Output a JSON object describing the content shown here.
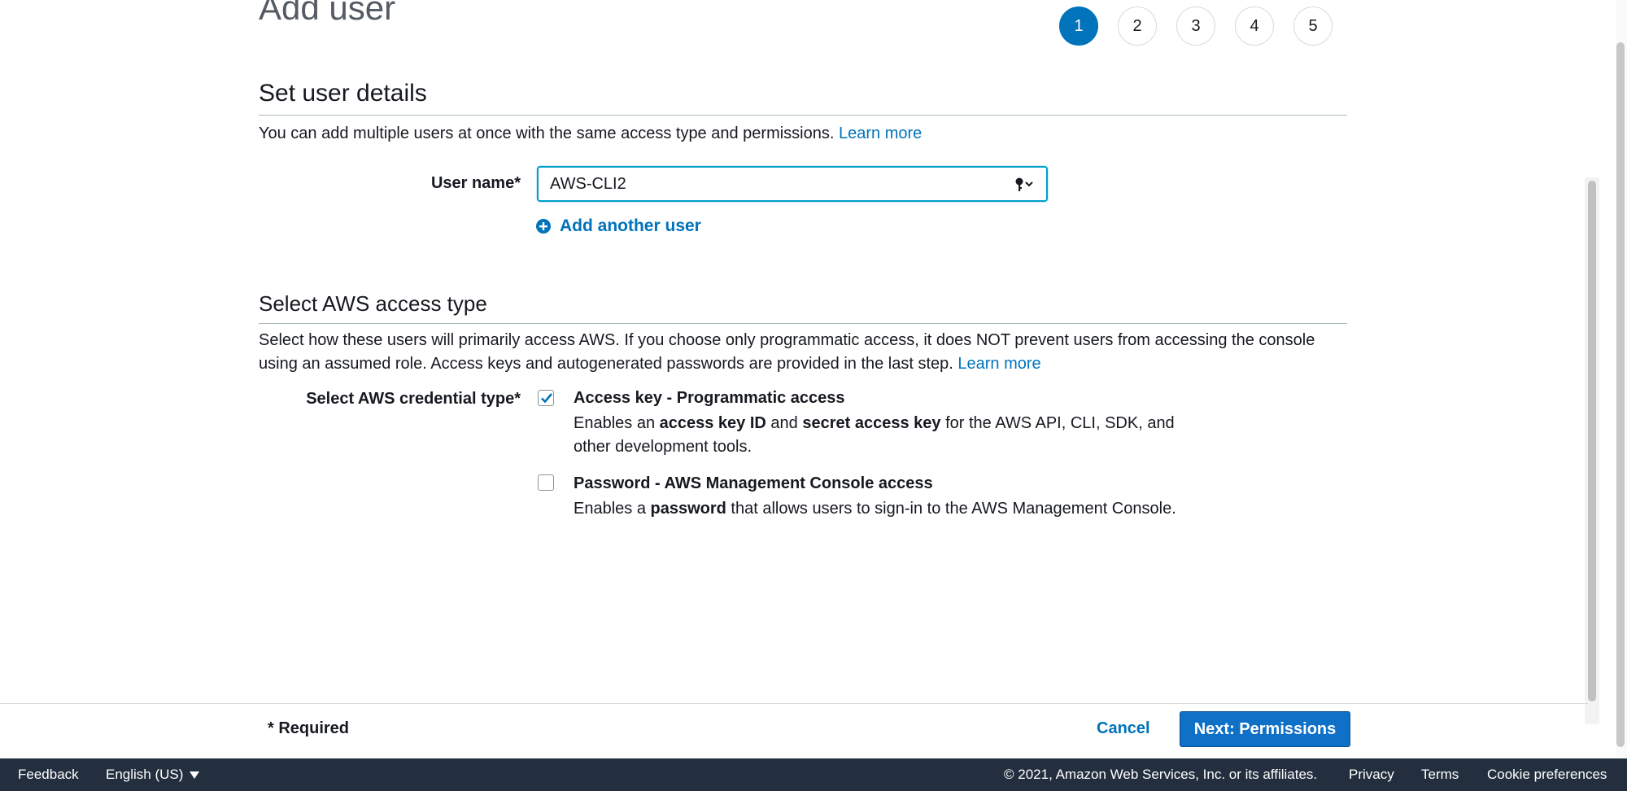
{
  "page_title": "Add user",
  "steps": [
    "1",
    "2",
    "3",
    "4",
    "5"
  ],
  "active_step": "1",
  "details": {
    "title": "Set user details",
    "description": "You can add multiple users at once with the same access type and permissions.",
    "learn_more": "Learn more",
    "user_name_label": "User name*",
    "user_name_value": "AWS-CLI2",
    "add_another_user": "Add another user"
  },
  "access": {
    "title": "Select AWS access type",
    "description": "Select how these users will primarily access AWS. If you choose only programmatic access, it does NOT prevent users from accessing the console using an assumed role. Access keys and autogenerated passwords are provided in the last step.",
    "learn_more": "Learn more",
    "credential_label": "Select AWS credential type*",
    "options": [
      {
        "title": "Access key - Programmatic access",
        "checked": true,
        "desc_1": "Enables an ",
        "desc_b1": "access key ID",
        "desc_2": " and ",
        "desc_b2": "secret access key",
        "desc_3": " for the AWS API, CLI, SDK, and",
        "desc_4": "other development tools."
      },
      {
        "title": "Password - AWS Management Console access",
        "checked": false,
        "desc_1": "Enables a ",
        "desc_b1": "password",
        "desc_2": " that allows users to sign-in to the AWS Management Console."
      }
    ]
  },
  "footer": {
    "required": "* Required",
    "cancel": "Cancel",
    "next": "Next: Permissions"
  },
  "bottom_bar": {
    "feedback": "Feedback",
    "language": "English (US)",
    "copyright": "© 2021, Amazon Web Services, Inc. or its affiliates.",
    "privacy": "Privacy",
    "terms": "Terms",
    "cookies": "Cookie preferences"
  },
  "colors": {
    "accent": "#0073bb",
    "primary_button": "#0f70c8",
    "bottom_bar": "#232f3e"
  },
  "icons": [
    "plus-circle-icon",
    "key-icon",
    "chevron-down-icon",
    "checkmark-icon",
    "caret-down-icon"
  ]
}
